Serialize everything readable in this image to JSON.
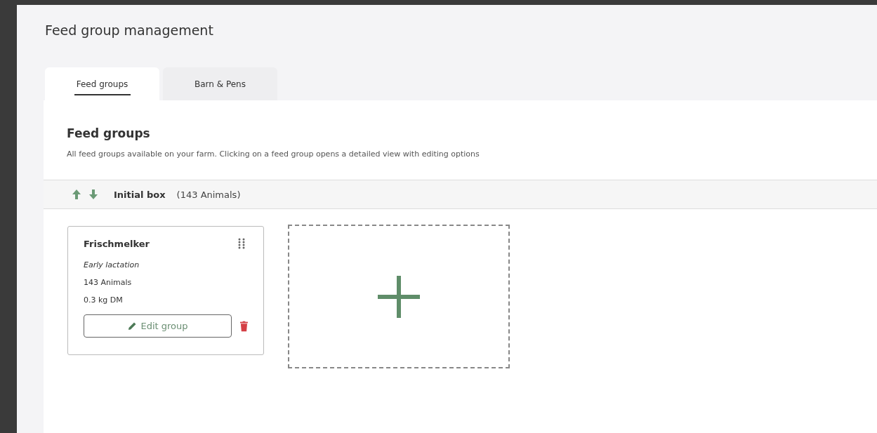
{
  "page": {
    "title": "Feed group management"
  },
  "tabs": [
    {
      "label": "Feed groups",
      "selected": true
    },
    {
      "label": "Barn & Pens",
      "selected": false
    }
  ],
  "section": {
    "title": "Feed groups",
    "description": "All feed groups available on your farm. Clicking on a feed group opens a detailed view with editing options"
  },
  "box": {
    "name": "Initial box",
    "count": "(143 Animals)"
  },
  "groups": [
    {
      "name": "Frischmelker",
      "phase": "Early lactation",
      "animals": "143 Animals",
      "feed": "0.3 kg DM",
      "edit_label": "Edit group"
    }
  ]
}
